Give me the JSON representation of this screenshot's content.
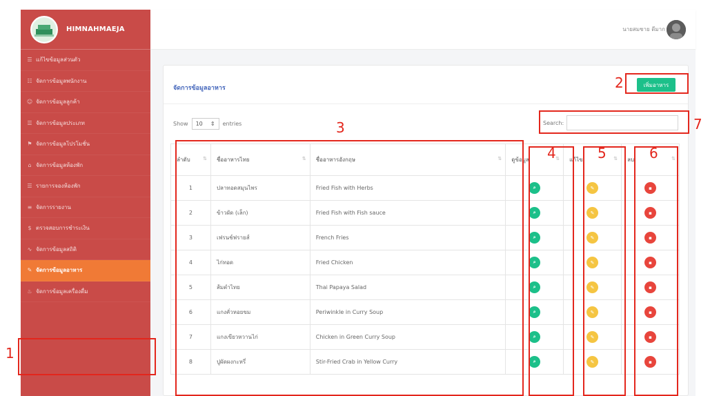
{
  "app": {
    "name": "HIMNAHMAEJA"
  },
  "sidebar": {
    "items": [
      {
        "label": "แก้ไขข้อมูลส่วนตัว",
        "icon": "list-icon"
      },
      {
        "label": "จัดการข้อมูลพนักงาน",
        "icon": "users-icon"
      },
      {
        "label": "จัดการข้อมูลลูกค้า",
        "icon": "user-icon"
      },
      {
        "label": "จัดการข้อมูลประเภท",
        "icon": "list-icon"
      },
      {
        "label": "จัดการข้อมูลโปรโมชั่น",
        "icon": "tag-icon"
      },
      {
        "label": "จัดการข้อมูลห้องพัก",
        "icon": "home-icon"
      },
      {
        "label": "รายการจองห้องพัก",
        "icon": "list-icon"
      },
      {
        "label": "จัดการรายงาน",
        "icon": "report-icon"
      },
      {
        "label": "ตรวจสอบการชำระเงิน",
        "icon": "money-icon"
      },
      {
        "label": "จัดการข้อมูลสถิติ",
        "icon": "chart-icon"
      },
      {
        "label": "จัดการข้อมูลอาหาร",
        "icon": "food-icon",
        "active": true
      },
      {
        "label": "จัดการข้อมูลเครื่องดื่ม",
        "icon": "drink-icon"
      }
    ]
  },
  "header": {
    "user_name": "นายสมชาย ดีมาก"
  },
  "page": {
    "title": "จัดการข้อมูลอาหาร",
    "add_button": "เพิ่มอาหาร",
    "show_label": "Show",
    "entries_value": "10",
    "entries_label": "entries",
    "search_label": "Search:"
  },
  "table": {
    "headers": [
      "ลำดับ",
      "ชื่ออาหารไทย",
      "ชื่ออาหารอังกฤษ",
      "ดูข้อมูล",
      "แก้ไข",
      "ลบ"
    ],
    "rows": [
      {
        "no": "1",
        "th": "ปลาทอดสมุนไพร",
        "en": "Fried Fish with Herbs"
      },
      {
        "no": "2",
        "th": "ข้าวผัด (เล็ก)",
        "en": "Fried Fish with Fish sauce"
      },
      {
        "no": "3",
        "th": "เฟรนช์ฟรายส์",
        "en": "French Fries"
      },
      {
        "no": "4",
        "th": "ไก่ทอด",
        "en": "Fried Chicken"
      },
      {
        "no": "5",
        "th": "ส้มตำไทย",
        "en": "Thai Papaya Salad"
      },
      {
        "no": "6",
        "th": "แกงคั่วหอยขม",
        "en": "Periwinkle in Curry Soup"
      },
      {
        "no": "7",
        "th": "แกงเขียวหวานไก่",
        "en": "Chicken in Green Curry Soup"
      },
      {
        "no": "8",
        "th": "ปูผัดผงกะหรี่",
        "en": "Stir-Fried Crab in Yellow Curry"
      }
    ]
  },
  "annotations": [
    "1",
    "2",
    "3",
    "4",
    "5",
    "6",
    "7"
  ],
  "colors": {
    "sidebar_bg": "#c94b48",
    "sidebar_active": "#f07a36",
    "add_button": "#1cc08a",
    "view_icon": "#1cc08a",
    "edit_icon": "#f5c542",
    "delete_icon": "#e8453c",
    "annotation": "#e3261c",
    "title": "#4466bb"
  }
}
